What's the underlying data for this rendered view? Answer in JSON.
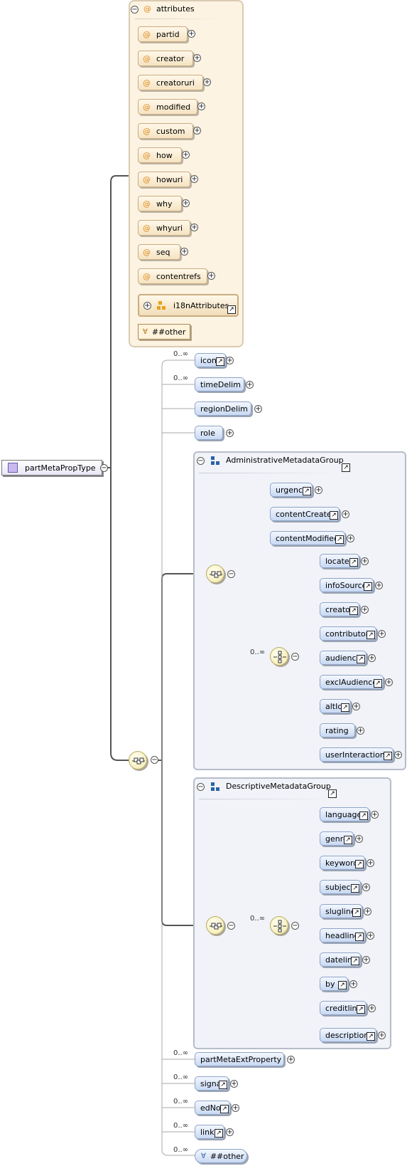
{
  "root": {
    "label": "partMetaPropType"
  },
  "attributes_panel": {
    "title": "attributes",
    "attrs": [
      "partid",
      "creator",
      "creatoruri",
      "modified",
      "custom",
      "how",
      "howuri",
      "why",
      "whyuri",
      "seq",
      "contentrefs"
    ],
    "group_ref": "i18nAttributes",
    "any_attribute": "##other"
  },
  "sequence_children": [
    {
      "label": "icon",
      "card": "0..∞",
      "ref": true
    },
    {
      "label": "timeDelim",
      "card": "0..∞",
      "ref": false
    },
    {
      "label": "regionDelim",
      "card": "",
      "ref": false
    },
    {
      "label": "role",
      "card": "",
      "ref": false
    }
  ],
  "admin_group": {
    "title": "AdministrativeMetadataGroup",
    "children": [
      {
        "label": "urgency",
        "ref": true
      },
      {
        "label": "contentCreated",
        "ref": true
      },
      {
        "label": "contentModified",
        "ref": true
      }
    ],
    "choice_card": "0..∞",
    "choice_children": [
      "located",
      "infoSource",
      "creator",
      "contributor",
      "audience",
      "exclAudience",
      "altId",
      "rating",
      "userInteraction"
    ]
  },
  "descr_group": {
    "title": "DescriptiveMetadataGroup",
    "choice_card": "0..∞",
    "choice_children": [
      "language",
      "genre",
      "keyword",
      "subject",
      "slugline",
      "headline",
      "dateline",
      "by",
      "creditline",
      "description"
    ]
  },
  "tail_children": [
    {
      "label": "partMetaExtProperty",
      "card": "0..∞",
      "ref": false
    },
    {
      "label": "signal",
      "card": "0..∞",
      "ref": true
    },
    {
      "label": "edNote",
      "card": "0..∞",
      "ref": true
    },
    {
      "label": "link",
      "card": "0..∞",
      "ref": true
    }
  ],
  "any_element": {
    "label": "##other",
    "card": "0..∞"
  },
  "colors": {
    "attribute_fill": "#fdf3e2",
    "element_fill": "#c8d9f3",
    "compositor_fill": "#f3e8a8",
    "group_fill": "#f1f3f8"
  },
  "icons": {
    "expand": "plus-circle-icon",
    "collapse": "minus-circle-icon",
    "reference": "reference-arrow-icon",
    "attribute": "at-sign-icon"
  }
}
